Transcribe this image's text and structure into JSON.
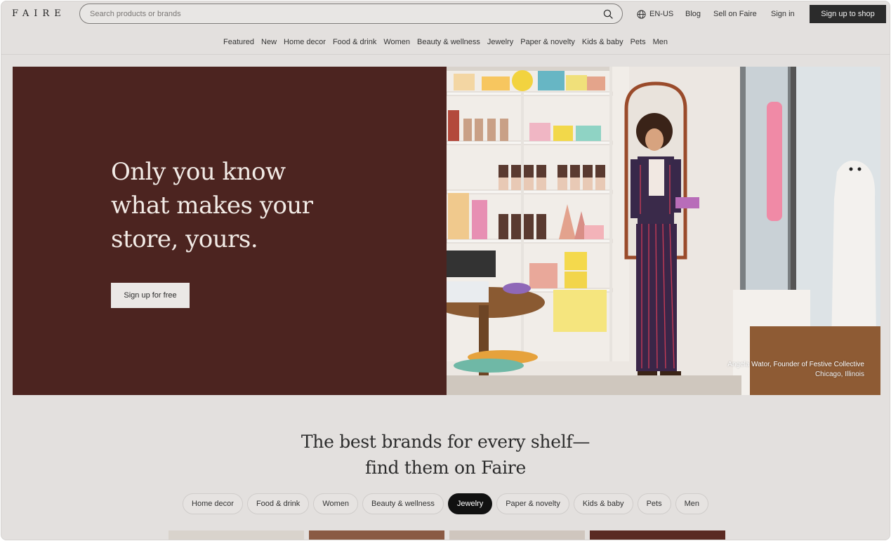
{
  "header": {
    "logo": "FAIRE",
    "search_placeholder": "Search products or brands",
    "locale": "EN-US",
    "links": {
      "blog": "Blog",
      "sell": "Sell on Faire",
      "signin": "Sign in"
    },
    "cta": "Sign up to shop"
  },
  "categories": [
    "Featured",
    "New",
    "Home decor",
    "Food & drink",
    "Women",
    "Beauty & wellness",
    "Jewelry",
    "Paper & novelty",
    "Kids & baby",
    "Pets",
    "Men"
  ],
  "hero": {
    "title": "Only you know what makes your store, yours.",
    "button": "Sign up for free",
    "caption_name": "Angela Wator, Founder of Festive Collective",
    "caption_place": "Chicago, Illinois",
    "background": "#4c2420"
  },
  "section": {
    "title_line1": "The best brands for every shelf—",
    "title_line2": "find them on Faire",
    "pills": [
      "Home decor",
      "Food & drink",
      "Women",
      "Beauty & wellness",
      "Jewelry",
      "Paper & novelty",
      "Kids & baby",
      "Pets",
      "Men"
    ],
    "active_pill": "Jewelry"
  }
}
